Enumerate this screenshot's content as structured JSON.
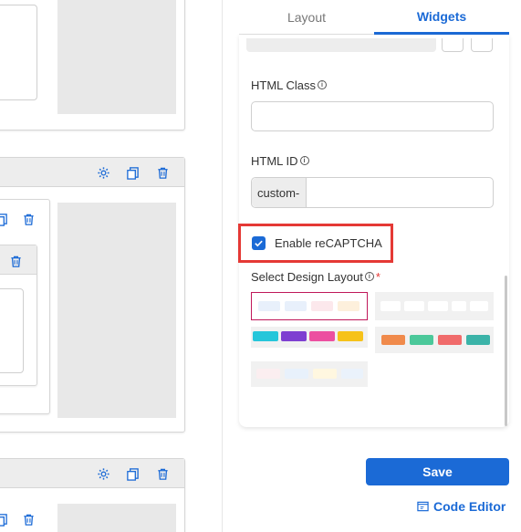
{
  "tabs": {
    "layout": "Layout",
    "widgets": "Widgets"
  },
  "fields": {
    "html_class": {
      "label": "HTML Class",
      "value": ""
    },
    "html_id": {
      "label": "HTML ID",
      "prefix": "custom-",
      "value": ""
    }
  },
  "recaptcha": {
    "label": "Enable reCAPTCHA",
    "checked": true
  },
  "design_layout": {
    "label": "Select Design Layout",
    "required_mark": "*"
  },
  "buttons": {
    "save": "Save",
    "code_editor": "Code Editor"
  },
  "colors": {
    "accent": "#1b6ad6",
    "highlight": "#e53935",
    "selected_border": "#c0185a"
  }
}
